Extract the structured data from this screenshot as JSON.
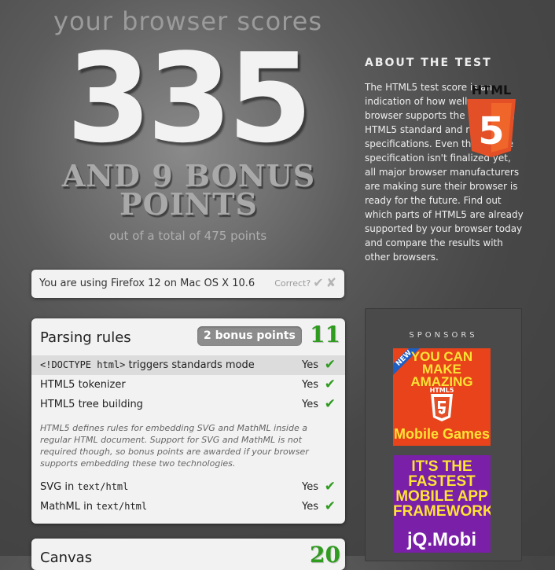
{
  "header": {
    "headline": "your browser scores",
    "score": "335",
    "bonus_text": "AND 9 BONUS POINTS",
    "total_text": "out of a total of 475 points"
  },
  "browser_check": {
    "text": "You are using Firefox 12 on Mac OS X 10.6",
    "correct_label": "Correct?"
  },
  "sections": [
    {
      "title": "Parsing rules",
      "bonus": "2 bonus points",
      "score": "11",
      "rows": [
        {
          "code": "<!DOCTYPE html>",
          "label": "triggers standards mode",
          "result": "Yes"
        },
        {
          "label": "HTML5 tokenizer",
          "result": "Yes"
        },
        {
          "label": "HTML5 tree building",
          "result": "Yes"
        }
      ],
      "note": "HTML5 defines rules for embedding SVG and MathML inside a regular HTML document. Support for SVG and MathML is not required though, so bonus points are awarded if your browser supports embedding these two technologies.",
      "bonus_rows": [
        {
          "label": "SVG in",
          "code": "text/html",
          "result": "Yes"
        },
        {
          "label": "MathML in",
          "code": "text/html",
          "result": "Yes"
        }
      ]
    },
    {
      "title": "Canvas",
      "score": "20"
    }
  ],
  "sidebar": {
    "title": "ABOUT THE TEST",
    "text": "The HTML5 test score is an indication of how well your browser supports the upcoming HTML5 standard and related specifications. Even though the specification isn't finalized yet, all major browser manufacturers are making sure their browser is ready for the future. Find out which parts of HTML5 are already supported by your browser today and compare the results with other browsers.",
    "logo_text": "HTML",
    "logo_number": "5"
  },
  "sponsors": {
    "title": "SPONSORS",
    "ad1": {
      "ribbon": "NEW",
      "line1": "YOU CAN MAKE AMAZING",
      "mini": "HTML5",
      "line2": "Mobile Games"
    },
    "ad2": {
      "line1": "IT'S THE FASTEST MOBILE APP FRAMEWORK",
      "line2": "jQ.Mobi"
    }
  },
  "colors": {
    "accent_green": "#2f9b1f",
    "html5_orange": "#e8431b",
    "ad_purple": "#7a1fa8",
    "ad_yellow": "#fde335"
  }
}
